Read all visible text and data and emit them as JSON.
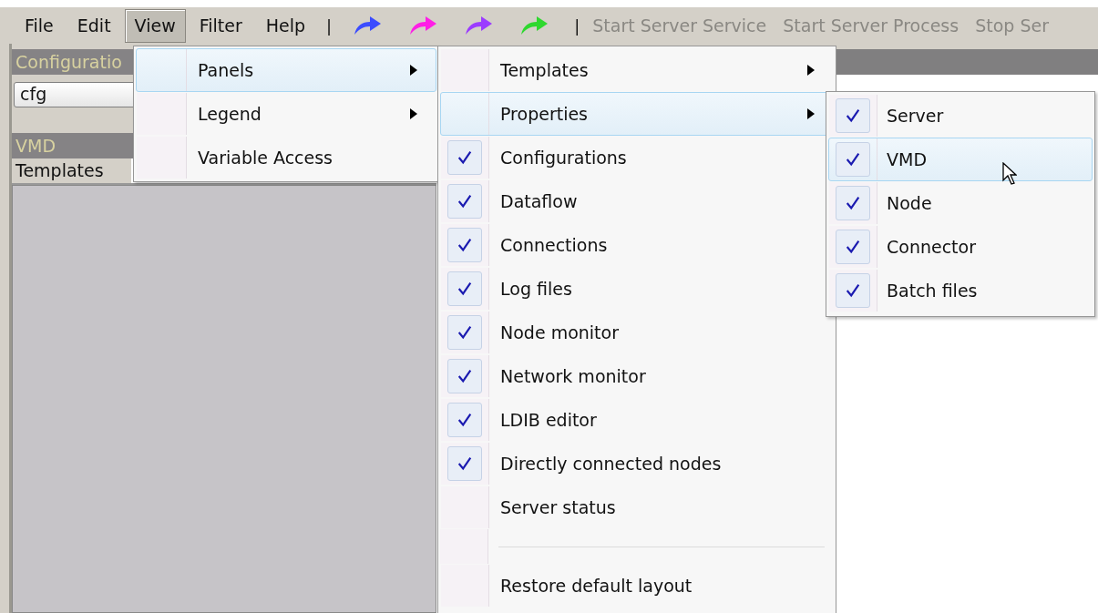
{
  "menubar": {
    "items": [
      {
        "label": "File",
        "selected": false
      },
      {
        "label": "Edit",
        "selected": false
      },
      {
        "label": "View",
        "selected": true
      },
      {
        "label": "Filter",
        "selected": false
      },
      {
        "label": "Help",
        "selected": false
      }
    ]
  },
  "toolbar": {
    "items": [
      {
        "kind": "separator",
        "text": "|"
      },
      {
        "kind": "arrow",
        "color": "#3b4cff"
      },
      {
        "kind": "arrow",
        "color": "#ff1ee6"
      },
      {
        "kind": "arrow",
        "color": "#9b3cff"
      },
      {
        "kind": "arrow",
        "color": "#2ed82e"
      },
      {
        "kind": "separator",
        "text": "|"
      },
      {
        "kind": "command",
        "label": "Start Server Service",
        "disabled": true
      },
      {
        "kind": "command",
        "label": "Start Server Process",
        "disabled": true
      },
      {
        "kind": "command",
        "label": "Stop Ser",
        "disabled": true
      }
    ]
  },
  "left_panel": {
    "header": "Configuratio",
    "combo": {
      "value": "cfg"
    },
    "subheader": "VMD",
    "tab": "Templates"
  },
  "menus": [
    {
      "items": [
        {
          "kind": "item",
          "label": "Panels",
          "submenu": true,
          "selected": true,
          "checked": false
        },
        {
          "kind": "item",
          "label": "Legend",
          "submenu": true,
          "selected": false,
          "checked": false
        },
        {
          "kind": "item",
          "label": "Variable Access",
          "submenu": false,
          "selected": false,
          "checked": false
        }
      ]
    },
    {
      "items": [
        {
          "kind": "item",
          "label": "Templates",
          "submenu": true,
          "selected": false,
          "checked": false
        },
        {
          "kind": "item",
          "label": "Properties",
          "submenu": true,
          "selected": true,
          "checked": false
        },
        {
          "kind": "item",
          "label": "Configurations",
          "submenu": false,
          "selected": false,
          "checked": true
        },
        {
          "kind": "item",
          "label": "Dataflow",
          "submenu": false,
          "selected": false,
          "checked": true
        },
        {
          "kind": "item",
          "label": "Connections",
          "submenu": false,
          "selected": false,
          "checked": true
        },
        {
          "kind": "item",
          "label": "Log files",
          "submenu": false,
          "selected": false,
          "checked": true
        },
        {
          "kind": "item",
          "label": "Node monitor",
          "submenu": false,
          "selected": false,
          "checked": true
        },
        {
          "kind": "item",
          "label": "Network monitor",
          "submenu": false,
          "selected": false,
          "checked": true
        },
        {
          "kind": "item",
          "label": "LDIB editor",
          "submenu": false,
          "selected": false,
          "checked": true
        },
        {
          "kind": "item",
          "label": "Directly connected nodes",
          "submenu": false,
          "selected": false,
          "checked": true
        },
        {
          "kind": "item",
          "label": "Server status",
          "submenu": false,
          "selected": false,
          "checked": false
        },
        {
          "kind": "separator"
        },
        {
          "kind": "item",
          "label": "Restore default layout",
          "submenu": false,
          "selected": false,
          "checked": false
        }
      ]
    },
    {
      "items": [
        {
          "kind": "item",
          "label": "Server",
          "submenu": false,
          "selected": false,
          "checked": true
        },
        {
          "kind": "item",
          "label": "VMD",
          "submenu": false,
          "selected": true,
          "checked": true
        },
        {
          "kind": "item",
          "label": "Node",
          "submenu": false,
          "selected": false,
          "checked": true
        },
        {
          "kind": "item",
          "label": "Connector",
          "submenu": false,
          "selected": false,
          "checked": true
        },
        {
          "kind": "item",
          "label": "Batch files",
          "submenu": false,
          "selected": false,
          "checked": true
        }
      ]
    }
  ]
}
